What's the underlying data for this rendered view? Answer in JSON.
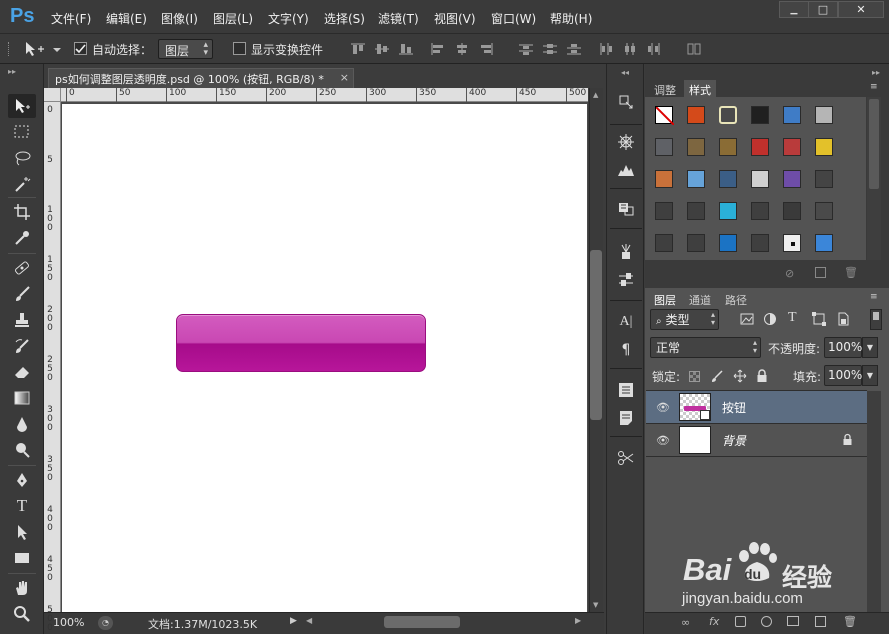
{
  "app": {
    "logo": "Ps"
  },
  "menu": [
    "文件(F)",
    "编辑(E)",
    "图像(I)",
    "图层(L)",
    "文字(Y)",
    "选择(S)",
    "滤镜(T)",
    "视图(V)",
    "窗口(W)",
    "帮助(H)"
  ],
  "window_controls": {
    "minimize": "▁",
    "maximize": "□",
    "close": "✕"
  },
  "options": {
    "auto_select_label": "自动选择：",
    "auto_select_checked": true,
    "auto_select_target": "图层",
    "show_transform_label": "显示变换控件",
    "show_transform_checked": false
  },
  "document": {
    "tab_title": "ps如何调整图层透明度.psd @ 100% (按钮, RGB/8) *",
    "close": "×",
    "ruler_h": [
      "0",
      "50",
      "100",
      "150",
      "200",
      "250",
      "300",
      "350",
      "400",
      "450",
      "500"
    ],
    "ruler_v": [
      "0",
      "5",
      "1 0 0",
      "1 5 0",
      "2 0 0",
      "2 5 0",
      "3 0 0",
      "3 5 0",
      "4 0 0",
      "4 5 0",
      "5 0 0"
    ]
  },
  "status": {
    "zoom": "100%",
    "doc_info": "文档:1.37M/1023.5K"
  },
  "styles_panel": {
    "tabs": [
      "调整",
      "样式"
    ],
    "active_tab": "样式",
    "swatches": [
      [
        "none",
        "#d44a1a",
        "#b9b48a",
        "#202020",
        "#3f7cc6",
        "#b5b5b5"
      ],
      [
        "#5f6166",
        "#7d6640",
        "#8a6c35",
        "#c0302c",
        "#b93b3b",
        "#e3c12a"
      ],
      [
        "#c9713a",
        "#66a3d9",
        "#3b5e86",
        "#cfcfcf",
        "#6e4da8",
        "#444444"
      ],
      [
        "#3f3f3f",
        "#3f3f3f",
        "#2ab0d8",
        "#3f3f3f",
        "#3a3a3a",
        "#4a4a4a"
      ],
      [
        "#3f3f3f",
        "#3f3f3f",
        "#1b73c4",
        "#3f3f3f",
        "#efefef",
        "#3b86d9"
      ]
    ]
  },
  "layers_panel": {
    "tabs": [
      "图层",
      "通道",
      "路径"
    ],
    "active_tab": "图层",
    "filter_kind": "类型",
    "blend_mode": "正常",
    "opacity_label": "不透明度:",
    "opacity_value": "100%",
    "lock_label": "锁定:",
    "fill_label": "填充:",
    "fill_value": "100%",
    "layers": [
      {
        "name": "按钮",
        "visible": true,
        "selected": true
      },
      {
        "name": "背景",
        "visible": true,
        "selected": false,
        "locked": true
      }
    ]
  },
  "watermark": {
    "brand": "Bai",
    "brand2": "du",
    "brand_cn": "经验",
    "url": "jingyan.baidu.com"
  },
  "colors": {
    "button_top": "#d35cbf",
    "button_bottom": "#a60b8a",
    "ps_blue": "#4aa3e6",
    "selected_layer": "#5c6d82"
  }
}
